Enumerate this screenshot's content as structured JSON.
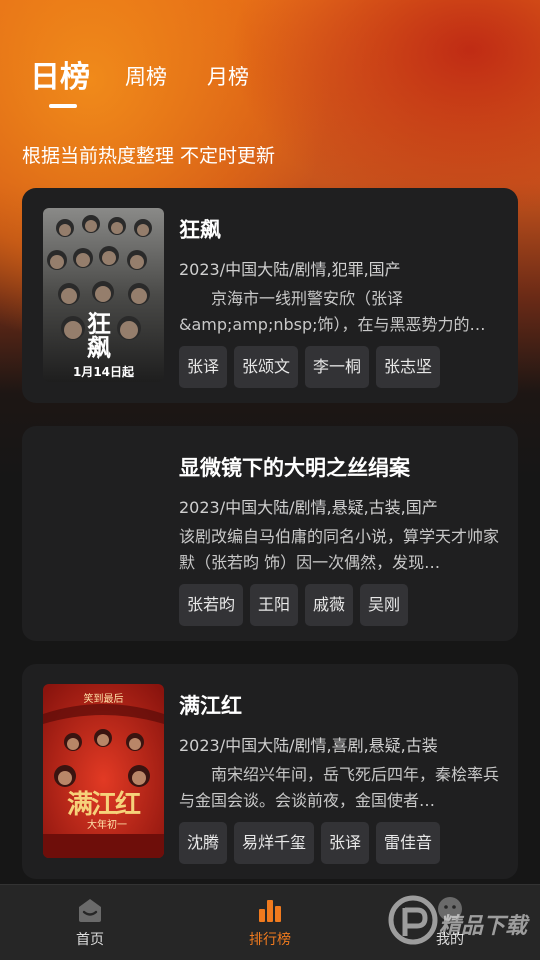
{
  "tabs": [
    {
      "label": "日榜",
      "active": true
    },
    {
      "label": "周榜",
      "active": false
    },
    {
      "label": "月榜",
      "active": false
    }
  ],
  "subtitle": "根据当前热度整理 不定时更新",
  "cards": [
    {
      "title": "狂飙",
      "meta": "2023/中国大陆/剧情,犯罪,国产",
      "description": "京海市一线刑警安欣（张译&amp;amp;nbsp;饰），在与黑恶势力的…",
      "tags": [
        "张译",
        "张颂文",
        "李一桐",
        "张志坚"
      ],
      "poster_text": "狂飙",
      "poster_date": "1月14日起"
    },
    {
      "title": "显微镜下的大明之丝绢案",
      "meta": "2023/中国大陆/剧情,悬疑,古装,国产",
      "description": "该剧改编自马伯庸的同名小说，算学天才帅家默（张若昀 饰）因一次偶然，发现…",
      "tags": [
        "张若昀",
        "王阳",
        "戚薇",
        "吴刚"
      ]
    },
    {
      "title": "满江红",
      "meta": "2023/中国大陆/剧情,喜剧,悬疑,古装",
      "description": "南宋绍兴年间，岳飞死后四年，秦桧率兵与金国会谈。会谈前夜，金国使者…",
      "tags": [
        "沈腾",
        "易烊千玺",
        "张译",
        "雷佳音"
      ],
      "poster_text": "满江红",
      "poster_top": "笑到最后",
      "poster_sub": "大年初一"
    }
  ],
  "nav": [
    {
      "label": "首页",
      "icon": "home-icon"
    },
    {
      "label": "排行榜",
      "icon": "chart-icon",
      "active": true
    },
    {
      "label": "我的",
      "icon": "user-icon"
    }
  ],
  "watermark": {
    "text": "精品下载"
  },
  "colors": {
    "accent": "#f07a1e",
    "card": "#1f1f20",
    "tag": "#333336"
  }
}
